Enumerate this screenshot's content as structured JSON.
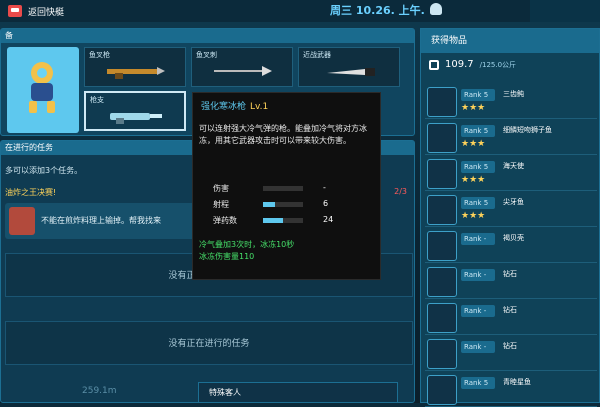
{
  "topbar": {
    "back_label": "返回快艇",
    "datetime": "周三 10.26. 上午."
  },
  "equipment": {
    "header": "备",
    "slots": [
      {
        "label": "鱼叉枪"
      },
      {
        "label": "鱼叉刺"
      },
      {
        "label": "近战武器"
      },
      {
        "label": "枪支"
      }
    ]
  },
  "tasks": {
    "header": "在进行的任务",
    "subtitle": "多可以添加3个任务。",
    "event_title": "油炸之王决赛!",
    "event_count": "2/3",
    "task_text": "不能在煎炸料理上输掉。帮我找来",
    "empty_1": "没有正在进行的任务",
    "empty_2": "没有正在进行的任务",
    "special_label": "特殊客人",
    "bottom_text": "259.1m"
  },
  "inventory": {
    "header": "获得物品",
    "weight": "109.7",
    "weight_max": "/125.0公斤",
    "items": [
      {
        "rank": "Rank 5",
        "name": "三齿鲀",
        "stars": "★★★"
      },
      {
        "rank": "Rank 5",
        "name": "细鳞短吻狮子鱼",
        "stars": "★★★"
      },
      {
        "rank": "Rank 5",
        "name": "海天使",
        "stars": "★★★"
      },
      {
        "rank": "Rank 5",
        "name": "尖牙鱼",
        "stars": "★★★"
      },
      {
        "rank": "Rank -",
        "name": "褐贝壳",
        "stars": ""
      },
      {
        "rank": "Rank -",
        "name": "钻石",
        "stars": ""
      },
      {
        "rank": "Rank -",
        "name": "钻石",
        "stars": ""
      },
      {
        "rank": "Rank -",
        "name": "钻石",
        "stars": ""
      },
      {
        "rank": "Rank 5",
        "name": "青睦星鱼",
        "stars": ""
      }
    ]
  },
  "tooltip": {
    "title": "强化寒冰枪",
    "level": "Lv.1",
    "desc": "可以连射强大冷气弹的枪。能叠加冷气将对方冰冻，用其它武器攻击时可以带来较大伤害。",
    "stats": [
      {
        "label": "伤害",
        "value": "-",
        "fill": 0
      },
      {
        "label": "射程",
        "value": "6",
        "fill": 0.3
      },
      {
        "label": "弹药数",
        "value": "24",
        "fill": 0.5
      }
    ],
    "effect_1": "冷气叠加3次时，冰冻10秒",
    "effect_2": "冰冻伤害量110"
  },
  "colors": {
    "accent": "#5ec8ee",
    "gold": "#ffd35a",
    "green": "#46e06a"
  }
}
